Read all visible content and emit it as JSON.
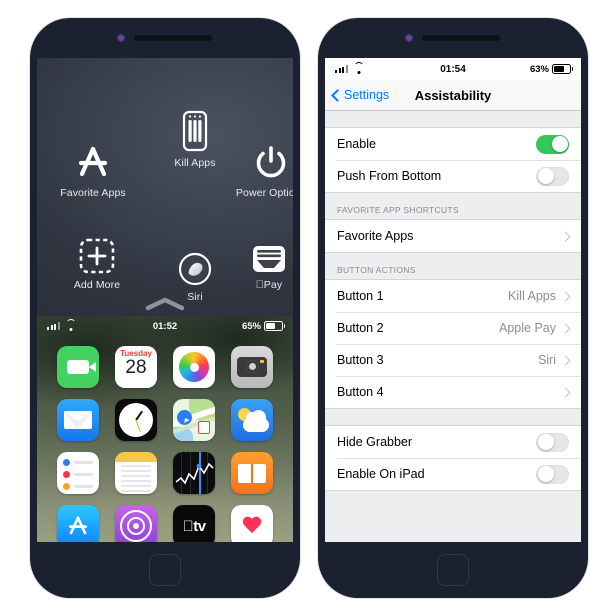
{
  "left_phone": {
    "name": "iphone-assistive-overlay",
    "overlay": {
      "items": [
        {
          "id": "favorite-apps",
          "label": "Favorite Apps",
          "icon": "app-store-a-icon"
        },
        {
          "id": "kill-apps",
          "label": "Kill Apps",
          "icon": "phone-app-switcher-icon"
        },
        {
          "id": "power-options",
          "label": "Power Options",
          "icon": "power-icon"
        },
        {
          "id": "add-more",
          "label": "Add More",
          "icon": "dashed-plus-icon"
        },
        {
          "id": "siri",
          "label": "Siri",
          "icon": "siri-orb-icon"
        },
        {
          "id": "apple-pay",
          "label": "Pay",
          "icon": "wallet-icon",
          "prefix": ""
        }
      ],
      "grabber": "chevron-up-icon"
    },
    "home": {
      "status": {
        "time": "01:52",
        "battery": "65%",
        "signal": "cellular-bars-icon",
        "wifi": "wifi-icon"
      },
      "apps": [
        {
          "name": "FaceTime",
          "icon": "facetime-icon"
        },
        {
          "name": "Calendar",
          "icon": "calendar-icon",
          "day": "Tuesday",
          "date": "28"
        },
        {
          "name": "Photos",
          "icon": "photos-icon"
        },
        {
          "name": "Camera",
          "icon": "camera-icon"
        },
        {
          "name": "Mail",
          "icon": "mail-icon"
        },
        {
          "name": "Clock",
          "icon": "clock-icon"
        },
        {
          "name": "Maps",
          "icon": "maps-icon"
        },
        {
          "name": "Weather",
          "icon": "weather-icon"
        },
        {
          "name": "Reminders",
          "icon": "reminders-icon"
        },
        {
          "name": "Notes",
          "icon": "notes-icon"
        },
        {
          "name": "Stocks",
          "icon": "stocks-icon"
        },
        {
          "name": "Books",
          "icon": "books-icon"
        },
        {
          "name": "App Store",
          "icon": "app-store-icon"
        },
        {
          "name": "Podcasts",
          "icon": "podcasts-icon"
        },
        {
          "name": "Apple TV",
          "icon": "apple-tv-icon",
          "label": "tv"
        },
        {
          "name": "Health",
          "icon": "health-icon"
        }
      ]
    }
  },
  "right_phone": {
    "name": "iphone-settings-assistability",
    "status": {
      "time": "01:54",
      "battery": "63%",
      "signal": "cellular-bars-icon",
      "wifi": "wifi-icon"
    },
    "navbar": {
      "back": "Settings",
      "title": "Assistability"
    },
    "sections": [
      {
        "header": "",
        "rows": [
          {
            "label": "Enable",
            "type": "switch",
            "on": true
          },
          {
            "label": "Push From Bottom",
            "type": "switch",
            "on": false
          }
        ]
      },
      {
        "header": "FAVORITE APP SHORTCUTS",
        "rows": [
          {
            "label": "Favorite Apps",
            "type": "nav",
            "value": ""
          }
        ]
      },
      {
        "header": "BUTTON ACTIONS",
        "rows": [
          {
            "label": "Button 1",
            "type": "nav",
            "value": "Kill Apps"
          },
          {
            "label": "Button 2",
            "type": "nav",
            "value": "Apple Pay"
          },
          {
            "label": "Button 3",
            "type": "nav",
            "value": "Siri"
          },
          {
            "label": "Button 4",
            "type": "nav",
            "value": ""
          }
        ]
      },
      {
        "header": "",
        "rows": [
          {
            "label": "Hide Grabber",
            "type": "switch",
            "on": false
          },
          {
            "label": "Enable On iPad",
            "type": "switch",
            "on": false
          }
        ]
      }
    ]
  },
  "colors": {
    "accent": "#007aff",
    "switch_on": "#34c759",
    "frame": "#1b2130",
    "group_bg": "#eeeef0",
    "value_text": "#8e8e93"
  }
}
